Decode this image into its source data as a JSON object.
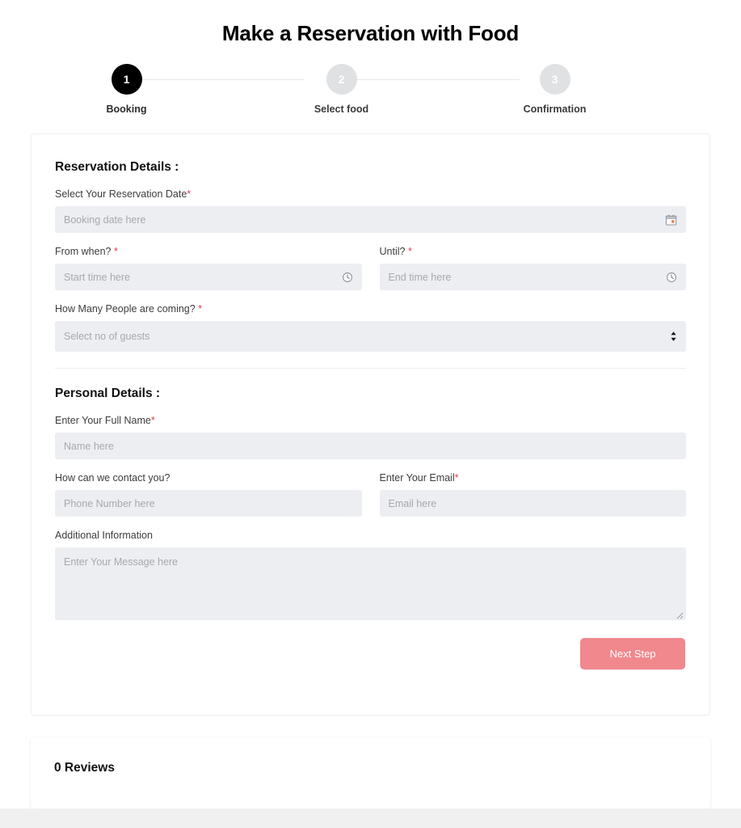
{
  "header": {
    "title": "Make a Reservation with Food"
  },
  "stepper": {
    "steps": [
      {
        "number": "1",
        "label": "Booking",
        "state": "active"
      },
      {
        "number": "2",
        "label": "Select food",
        "state": "inactive"
      },
      {
        "number": "3",
        "label": "Confirmation",
        "state": "inactive"
      }
    ]
  },
  "booking_form": {
    "reservation_section": {
      "title": "Reservation Details :",
      "date": {
        "label": "Select Your Reservation Date",
        "required_mark": "*",
        "placeholder": "Booking date here",
        "value": "",
        "icon": "calendar-icon"
      },
      "start_time": {
        "label": "From when?",
        "required_mark": "*",
        "placeholder": "Start time here",
        "value": "",
        "icon": "clock-icon"
      },
      "end_time": {
        "label": "Until?",
        "required_mark": "*",
        "placeholder": "End time here",
        "value": "",
        "icon": "clock-icon"
      },
      "guests": {
        "label": "How Many People are coming?",
        "required_mark": "*",
        "placeholder": "Select no of guests",
        "selected": "Select no of guests",
        "icon": "select-updown-icon"
      }
    },
    "personal_section": {
      "title": "Personal Details :",
      "full_name": {
        "label": "Enter Your Full Name",
        "required_mark": "*",
        "placeholder": "Name here",
        "value": ""
      },
      "phone": {
        "label": "How can we contact you?",
        "required_mark": "",
        "placeholder": "Phone Number here",
        "value": ""
      },
      "email": {
        "label": "Enter Your Email",
        "required_mark": "*",
        "placeholder": "Email here",
        "value": ""
      },
      "message": {
        "label": "Additional Information",
        "required_mark": "",
        "placeholder": "Enter Your Message here",
        "value": ""
      }
    },
    "next_button": "Next Step"
  },
  "reviews": {
    "title": "0 Reviews"
  },
  "colors": {
    "accent_button": "#f0888d",
    "active_step": "#000000",
    "inactive_step": "#dfe1e3",
    "required_asterisk": "#e8384f",
    "input_background": "#eceef2",
    "page_background": "#ffffff"
  }
}
